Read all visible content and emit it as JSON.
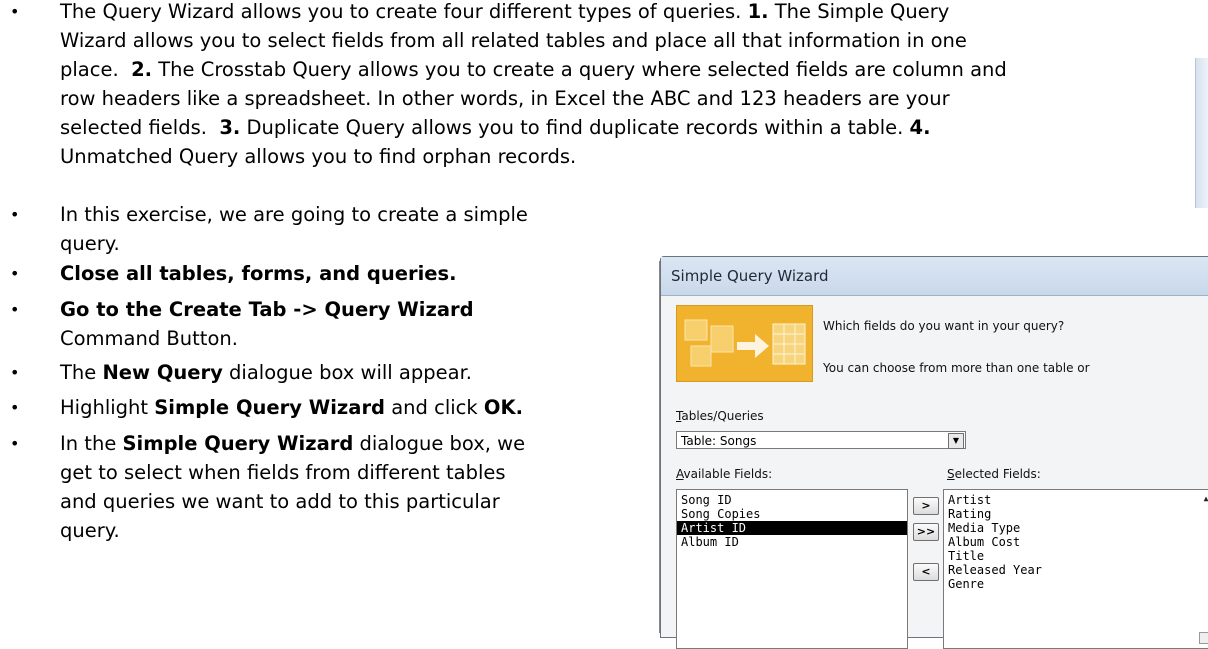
{
  "document": {
    "paragraphs": [
      {
        "lines": [
          [
            {
              "t": "The Query Wizard allows you to create four different types of queries. "
            },
            {
              "t": "1.",
              "b": true
            },
            {
              "t": " The Simple Query"
            }
          ],
          [
            {
              "t": "Wizard allows you to select fields from all related tables and place all that information in one"
            }
          ],
          [
            {
              "t": "place.  "
            },
            {
              "t": "2.",
              "b": true
            },
            {
              "t": " The Crosstab Query allows you to create a query where selected fields are column and"
            }
          ],
          [
            {
              "t": "row headers like a spreadsheet. In other words, in Excel the ABC and 123 headers are your"
            }
          ],
          [
            {
              "t": "selected fields.  "
            },
            {
              "t": "3.",
              "b": true
            },
            {
              "t": " Duplicate Query allows you to find duplicate records within a table. "
            },
            {
              "t": "4.",
              "b": true
            }
          ],
          [
            {
              "t": "Unmatched Query allows you to find orphan records."
            }
          ]
        ]
      },
      {
        "lines": [
          [
            {
              "t": "In this exercise, we are going to create a simple"
            }
          ],
          [
            {
              "t": "query."
            }
          ]
        ]
      },
      {
        "lines": [
          [
            {
              "t": "Close all tables, forms, and queries.",
              "b": true
            }
          ]
        ]
      },
      {
        "lines": [
          [
            {
              "t": "Go to the Create Tab -> Query Wizard",
              "b": true
            }
          ],
          [
            {
              "t": "Command Button."
            }
          ]
        ]
      },
      {
        "lines": [
          [
            {
              "t": "The "
            },
            {
              "t": "New Query",
              "b": true
            },
            {
              "t": " dialogue box will appear."
            }
          ]
        ]
      },
      {
        "lines": [
          [
            {
              "t": "Highlight "
            },
            {
              "t": "Simple Query Wizard",
              "b": true
            },
            {
              "t": " and click "
            },
            {
              "t": "OK.",
              "b": true
            }
          ]
        ]
      },
      {
        "lines": [
          [
            {
              "t": "In the "
            },
            {
              "t": "Simple Query Wizard",
              "b": true
            },
            {
              "t": " dialogue box, we"
            }
          ],
          [
            {
              "t": "get to select when fields from different tables"
            }
          ],
          [
            {
              "t": "and queries we want to add to this particular"
            }
          ],
          [
            {
              "t": "query."
            }
          ]
        ]
      }
    ]
  },
  "dialog": {
    "title": "Simple Query Wizard",
    "prompt": "Which fields do you want in your query?",
    "subprompt": "You can choose from more than one table or",
    "tables_label": "Tables/Queries",
    "table_value": "Table: Songs",
    "available_label": "Available Fields:",
    "selected_label": "Selected Fields:",
    "available_fields": [
      "Song ID",
      "Song Copies",
      "Artist ID",
      "Album ID"
    ],
    "available_selected_index": 2,
    "selected_fields": [
      "Artist",
      "Rating",
      "Media Type",
      "Album Cost",
      "Title",
      "Released Year",
      "Genre"
    ],
    "buttons": {
      "add_one": ">",
      "add_all": ">>",
      "remove_one": "<"
    }
  }
}
